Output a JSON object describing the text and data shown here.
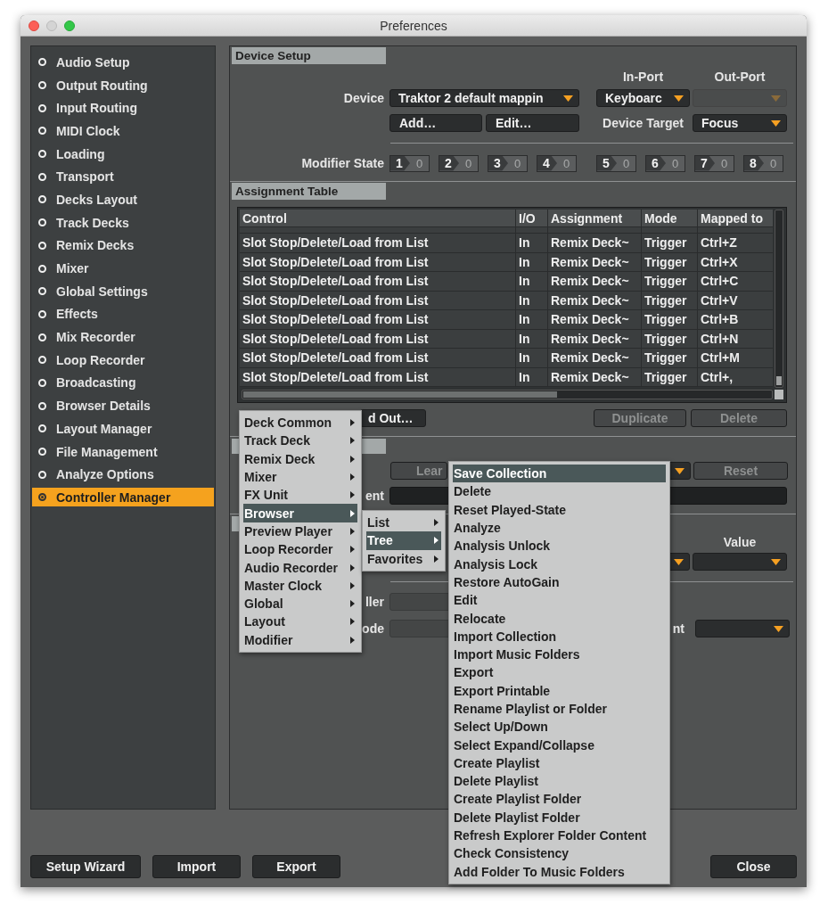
{
  "window": {
    "title": "Preferences"
  },
  "sidebar": {
    "items": [
      {
        "label": "Audio Setup",
        "selected": false
      },
      {
        "label": "Output Routing",
        "selected": false
      },
      {
        "label": "Input Routing",
        "selected": false
      },
      {
        "label": "MIDI Clock",
        "selected": false
      },
      {
        "label": "Loading",
        "selected": false
      },
      {
        "label": "Transport",
        "selected": false
      },
      {
        "label": "Decks Layout",
        "selected": false
      },
      {
        "label": "Track Decks",
        "selected": false
      },
      {
        "label": "Remix Decks",
        "selected": false
      },
      {
        "label": "Mixer",
        "selected": false
      },
      {
        "label": "Global Settings",
        "selected": false
      },
      {
        "label": "Effects",
        "selected": false
      },
      {
        "label": "Mix Recorder",
        "selected": false
      },
      {
        "label": "Loop Recorder",
        "selected": false
      },
      {
        "label": "Broadcasting",
        "selected": false
      },
      {
        "label": "Browser Details",
        "selected": false
      },
      {
        "label": "Layout Manager",
        "selected": false
      },
      {
        "label": "File Management",
        "selected": false
      },
      {
        "label": "Analyze Options",
        "selected": false
      },
      {
        "label": "Controller Manager",
        "selected": true
      }
    ]
  },
  "device_setup": {
    "title": "Device Setup",
    "in_port_label": "In-Port",
    "out_port_label": "Out-Port",
    "device_label": "Device",
    "device": {
      "value": "Traktor 2 default mappin",
      "disabled": false
    },
    "in_port": {
      "value": "Keyboarc",
      "disabled": false
    },
    "out_port": {
      "disabled": true
    },
    "add_button": "Add…",
    "edit_button": "Edit…",
    "device_target_label": "Device Target",
    "device_target": {
      "value": "Focus",
      "disabled": false
    },
    "modifier_state_label": "Modifier State",
    "modifiers": [
      {
        "number": "1",
        "value": "0"
      },
      {
        "number": "2",
        "value": "0"
      },
      {
        "number": "3",
        "value": "0"
      },
      {
        "number": "4",
        "value": "0"
      },
      {
        "number": "5",
        "value": "0"
      },
      {
        "number": "6",
        "value": "0"
      },
      {
        "number": "7",
        "value": "0"
      },
      {
        "number": "8",
        "value": "0"
      }
    ]
  },
  "assignment_table": {
    "title": "Assignment Table",
    "columns": [
      "Control",
      "I/O",
      "Assignment",
      "Mode",
      "Mapped to"
    ],
    "rows": [
      [
        "Slot Stop/Delete/Load from List",
        "In",
        "Remix Deck~",
        "Trigger",
        "Ctrl+Z"
      ],
      [
        "Slot Stop/Delete/Load from List",
        "In",
        "Remix Deck~",
        "Trigger",
        "Ctrl+X"
      ],
      [
        "Slot Stop/Delete/Load from List",
        "In",
        "Remix Deck~",
        "Trigger",
        "Ctrl+C"
      ],
      [
        "Slot Stop/Delete/Load from List",
        "In",
        "Remix Deck~",
        "Trigger",
        "Ctrl+V"
      ],
      [
        "Slot Stop/Delete/Load from List",
        "In",
        "Remix Deck~",
        "Trigger",
        "Ctrl+B"
      ],
      [
        "Slot Stop/Delete/Load from List",
        "In",
        "Remix Deck~",
        "Trigger",
        "Ctrl+N"
      ],
      [
        "Slot Stop/Delete/Load from List",
        "In",
        "Remix Deck~",
        "Trigger",
        "Ctrl+M"
      ],
      [
        "Slot Stop/Delete/Load from List",
        "In",
        "Remix Deck~",
        "Trigger",
        "Ctrl+,"
      ]
    ]
  },
  "table_buttons": [
    {
      "label": "d Out…",
      "disabled": false
    },
    {
      "label": "Duplicate",
      "disabled": true
    },
    {
      "label": "Delete",
      "disabled": true
    }
  ],
  "mapping_details": {
    "learn_button": {
      "label": "Lear",
      "disabled": true
    },
    "reset_button": {
      "label": "Reset",
      "disabled": true
    },
    "comment_label": "ent"
  },
  "modifier_conditions": {
    "value_label": "Value"
  },
  "mapping_options": {
    "controller_label": "ller",
    "mode_label": "ode",
    "third_label": "nt"
  },
  "context_menus": [
    {
      "items": [
        {
          "label": "Deck Common",
          "submenu": true,
          "selected": false
        },
        {
          "label": "Track Deck",
          "submenu": true,
          "selected": false
        },
        {
          "label": "Remix Deck",
          "submenu": true,
          "selected": false
        },
        {
          "label": "Mixer",
          "submenu": true,
          "selected": false
        },
        {
          "label": "FX Unit",
          "submenu": true,
          "selected": false
        },
        {
          "label": "Browser",
          "submenu": true,
          "selected": true
        },
        {
          "label": "Preview Player",
          "submenu": true,
          "selected": false
        },
        {
          "label": "Loop Recorder",
          "submenu": true,
          "selected": false
        },
        {
          "label": "Audio Recorder",
          "submenu": true,
          "selected": false
        },
        {
          "label": "Master Clock",
          "submenu": true,
          "selected": false
        },
        {
          "label": "Global",
          "submenu": true,
          "selected": false
        },
        {
          "label": "Layout",
          "submenu": true,
          "selected": false
        },
        {
          "label": "Modifier",
          "submenu": true,
          "selected": false
        }
      ]
    },
    {
      "items": [
        {
          "label": "List",
          "submenu": true,
          "selected": false
        },
        {
          "label": "Tree",
          "submenu": true,
          "selected": true
        },
        {
          "label": "Favorites",
          "submenu": true,
          "selected": false
        }
      ]
    },
    {
      "items": [
        {
          "label": "Save Collection",
          "submenu": false,
          "selected": true
        },
        {
          "label": "Delete",
          "submenu": false,
          "selected": false
        },
        {
          "label": "Reset Played-State",
          "submenu": false,
          "selected": false
        },
        {
          "label": "Analyze",
          "submenu": false,
          "selected": false
        },
        {
          "label": "Analysis Unlock",
          "submenu": false,
          "selected": false
        },
        {
          "label": "Analysis Lock",
          "submenu": false,
          "selected": false
        },
        {
          "label": "Restore AutoGain",
          "submenu": false,
          "selected": false
        },
        {
          "label": "Edit",
          "submenu": false,
          "selected": false
        },
        {
          "label": "Relocate",
          "submenu": false,
          "selected": false
        },
        {
          "label": "Import Collection",
          "submenu": false,
          "selected": false
        },
        {
          "label": "Import Music Folders",
          "submenu": false,
          "selected": false
        },
        {
          "label": "Export",
          "submenu": false,
          "selected": false
        },
        {
          "label": "Export Printable",
          "submenu": false,
          "selected": false
        },
        {
          "label": "Rename Playlist or Folder",
          "submenu": false,
          "selected": false
        },
        {
          "label": "Select Up/Down",
          "submenu": false,
          "selected": false
        },
        {
          "label": "Select Expand/Collapse",
          "submenu": false,
          "selected": false
        },
        {
          "label": "Create Playlist",
          "submenu": false,
          "selected": false
        },
        {
          "label": "Delete Playlist",
          "submenu": false,
          "selected": false
        },
        {
          "label": "Create Playlist Folder",
          "submenu": false,
          "selected": false
        },
        {
          "label": "Delete Playlist Folder",
          "submenu": false,
          "selected": false
        },
        {
          "label": "Refresh Explorer Folder Content",
          "submenu": false,
          "selected": false
        },
        {
          "label": "Check Consistency",
          "submenu": false,
          "selected": false
        },
        {
          "label": "Add Folder To Music Folders",
          "submenu": false,
          "selected": false
        }
      ]
    }
  ],
  "footer_buttons": [
    "Setup Wizard",
    "Import",
    "Export"
  ],
  "close_button": "Close"
}
